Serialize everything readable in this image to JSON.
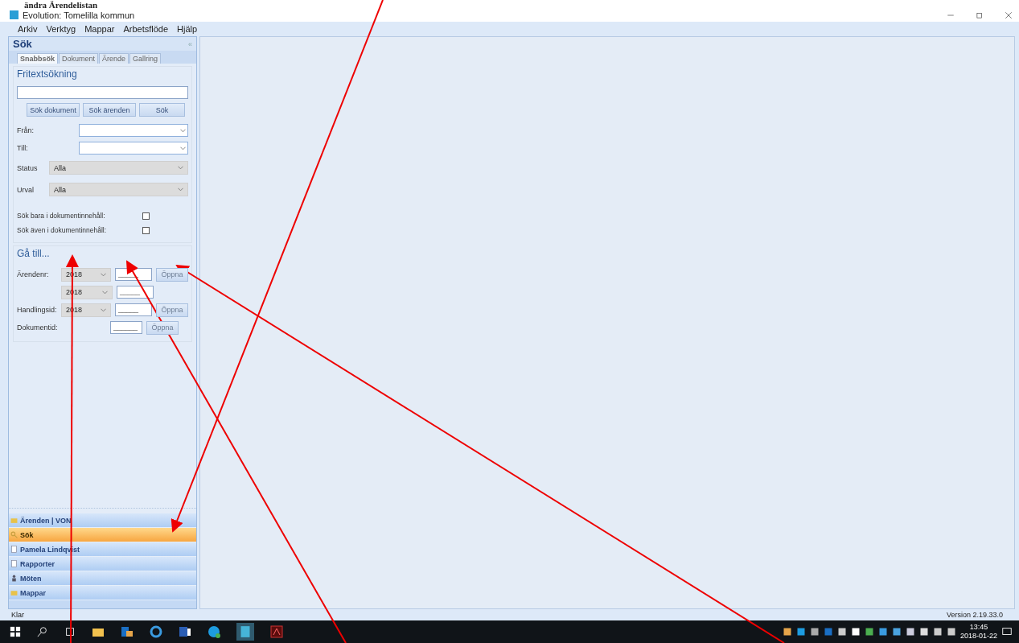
{
  "caption": "ändra Ärendelistan",
  "window": {
    "title": "Evolution: Tomelilla kommun"
  },
  "menu": [
    "Arkiv",
    "Verktyg",
    "Mappar",
    "Arbetsflöde",
    "Hjälp"
  ],
  "panel": {
    "title": "Sök",
    "collapse": "«",
    "tabs": [
      {
        "label": "Snabbsök",
        "selected": true
      },
      {
        "label": "Dokument",
        "selected": false
      },
      {
        "label": "Ärende",
        "selected": false
      },
      {
        "label": "Gallring",
        "selected": false
      }
    ],
    "freetext": {
      "title": "Fritextsökning",
      "buttons": [
        "Sök dokument",
        "Sök ärenden",
        "Sök"
      ],
      "dates": [
        {
          "label": "Från:"
        },
        {
          "label": "Till:"
        }
      ],
      "selects": [
        {
          "label": "Status",
          "value": "Alla"
        },
        {
          "label": "Urval",
          "value": "Alla"
        }
      ],
      "checkboxes": [
        {
          "label": "Sök bara i dokumentinnehåll:",
          "checked": false
        },
        {
          "label": "Sök även i dokumentinnehåll:",
          "checked": false
        }
      ]
    },
    "goto": {
      "title": "Gå till...",
      "rows": [
        {
          "label": "Ärendenr:",
          "year": "2018",
          "value": "_____",
          "button": "Öppna",
          "disabled": true
        },
        {
          "year": "2018",
          "value": "_____"
        },
        {
          "label": "Handlingsid:",
          "year": "2018",
          "value": "_____",
          "button": "Öppna",
          "disabled": true
        },
        {
          "label": "Dokumentid:",
          "value": "______",
          "button": "Öppna",
          "disabled": true
        }
      ]
    }
  },
  "nav": [
    {
      "label": "Ärenden | VON",
      "kind": "folder",
      "selected": false
    },
    {
      "label": "Sök",
      "kind": "search",
      "selected": true
    },
    {
      "label": "Pamela Lindqvist",
      "kind": "document",
      "selected": false
    },
    {
      "label": "Rapporter",
      "kind": "report",
      "selected": false
    },
    {
      "label": "Möten",
      "kind": "meeting",
      "selected": false
    },
    {
      "label": "Mappar",
      "kind": "folder",
      "selected": false
    }
  ],
  "status_bar": {
    "left": "Klar",
    "right": "Version 2.19.33.0"
  },
  "taskbar": {
    "time": "13:45",
    "date": "2018-01-22"
  }
}
